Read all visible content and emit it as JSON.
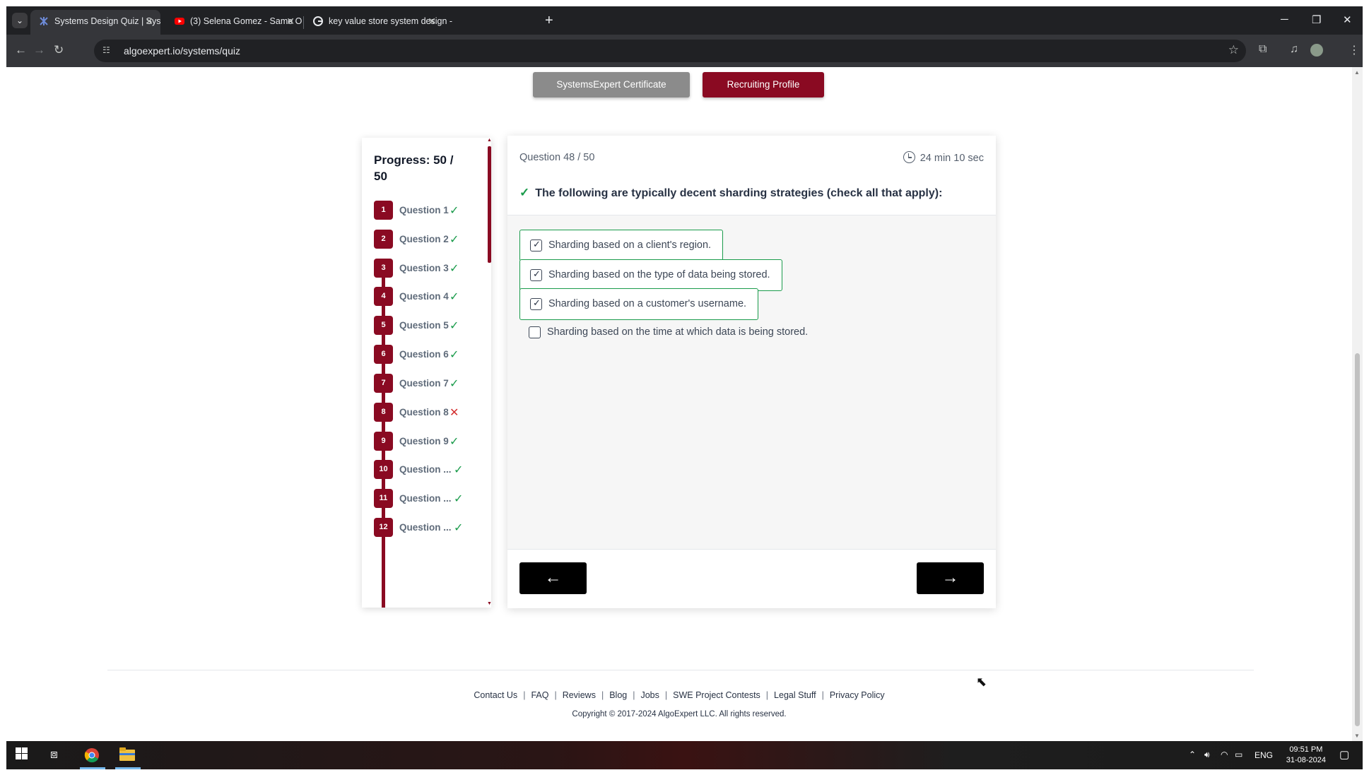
{
  "browser": {
    "tabs": [
      {
        "title": "Systems Design Quiz | SystemsE",
        "active": true
      },
      {
        "title": "(3) Selena Gomez - Same Old L",
        "active": false
      },
      {
        "title": "key value store system design -",
        "active": false
      }
    ],
    "url": "algoexpert.io/systems/quiz"
  },
  "header": {
    "certificate_label": "SystemsExpert Certificate",
    "recruiting_label": "Recruiting Profile"
  },
  "progress": {
    "title": "Progress: 50 / 50",
    "questions": [
      {
        "num": "1",
        "label": "Question 1",
        "status": "correct"
      },
      {
        "num": "2",
        "label": "Question 2",
        "status": "correct"
      },
      {
        "num": "3",
        "label": "Question 3",
        "status": "correct"
      },
      {
        "num": "4",
        "label": "Question 4",
        "status": "correct"
      },
      {
        "num": "5",
        "label": "Question 5",
        "status": "correct"
      },
      {
        "num": "6",
        "label": "Question 6",
        "status": "correct"
      },
      {
        "num": "7",
        "label": "Question 7",
        "status": "correct"
      },
      {
        "num": "8",
        "label": "Question 8",
        "status": "incorrect"
      },
      {
        "num": "9",
        "label": "Question 9",
        "status": "correct"
      },
      {
        "num": "10",
        "label": "Question ...",
        "status": "correct"
      },
      {
        "num": "11",
        "label": "Question ...",
        "status": "correct"
      },
      {
        "num": "12",
        "label": "Question ...",
        "status": "correct"
      }
    ]
  },
  "question": {
    "counter": "Question 48 / 50",
    "timer": "24 min 10 sec",
    "prompt": "The following are typically decent sharding strategies (check all that apply):",
    "options": [
      {
        "text": "Sharding based on a client's region.",
        "checked": true
      },
      {
        "text": "Sharding based on the type of data being stored.",
        "checked": true
      },
      {
        "text": "Sharding based on a customer's username.",
        "checked": true
      },
      {
        "text": "Sharding based on the time at which data is being stored.",
        "checked": false
      }
    ]
  },
  "footer": {
    "links": [
      "Contact Us",
      "FAQ",
      "Reviews",
      "Blog",
      "Jobs",
      "SWE Project Contests",
      "Legal Stuff",
      "Privacy Policy"
    ],
    "copyright": "Copyright © 2017-2024 AlgoExpert LLC. All rights reserved."
  },
  "taskbar": {
    "language": "ENG",
    "time": "09:51 PM",
    "date": "31-08-2024"
  },
  "colors": {
    "brand": "#8a0a22",
    "correct": "#1a9b4b",
    "incorrect": "#d32f2f"
  }
}
